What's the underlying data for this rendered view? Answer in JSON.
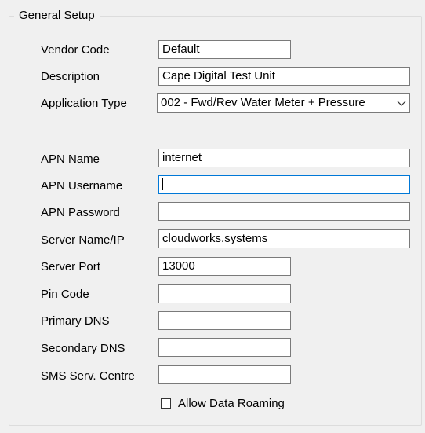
{
  "group": {
    "title": "General Setup"
  },
  "fields": {
    "vendor_code": {
      "label": "Vendor Code",
      "value": "Default"
    },
    "description": {
      "label": "Description",
      "value": "Cape Digital Test Unit"
    },
    "application_type": {
      "label": "Application Type",
      "value": "002 - Fwd/Rev Water Meter + Pressure"
    },
    "apn_name": {
      "label": "APN Name",
      "value": "internet"
    },
    "apn_username": {
      "label": "APN Username",
      "value": ""
    },
    "apn_password": {
      "label": "APN Password",
      "value": ""
    },
    "server_name": {
      "label": "Server Name/IP",
      "value": "cloudworks.systems"
    },
    "server_port": {
      "label": "Server Port",
      "value": "13000"
    },
    "pin_code": {
      "label": "Pin Code",
      "value": ""
    },
    "primary_dns": {
      "label": "Primary DNS",
      "value": ""
    },
    "secondary_dns": {
      "label": "Secondary DNS",
      "value": ""
    },
    "sms_centre": {
      "label": "SMS Serv. Centre",
      "value": ""
    }
  },
  "allow_data_roaming": {
    "label": "Allow Data Roaming",
    "checked": false
  },
  "icons": {
    "dropdown": "chevron-down-icon"
  },
  "colors": {
    "focus_border": "#0078d7",
    "field_border": "#7a7a7a",
    "background": "#f0f0f0"
  }
}
